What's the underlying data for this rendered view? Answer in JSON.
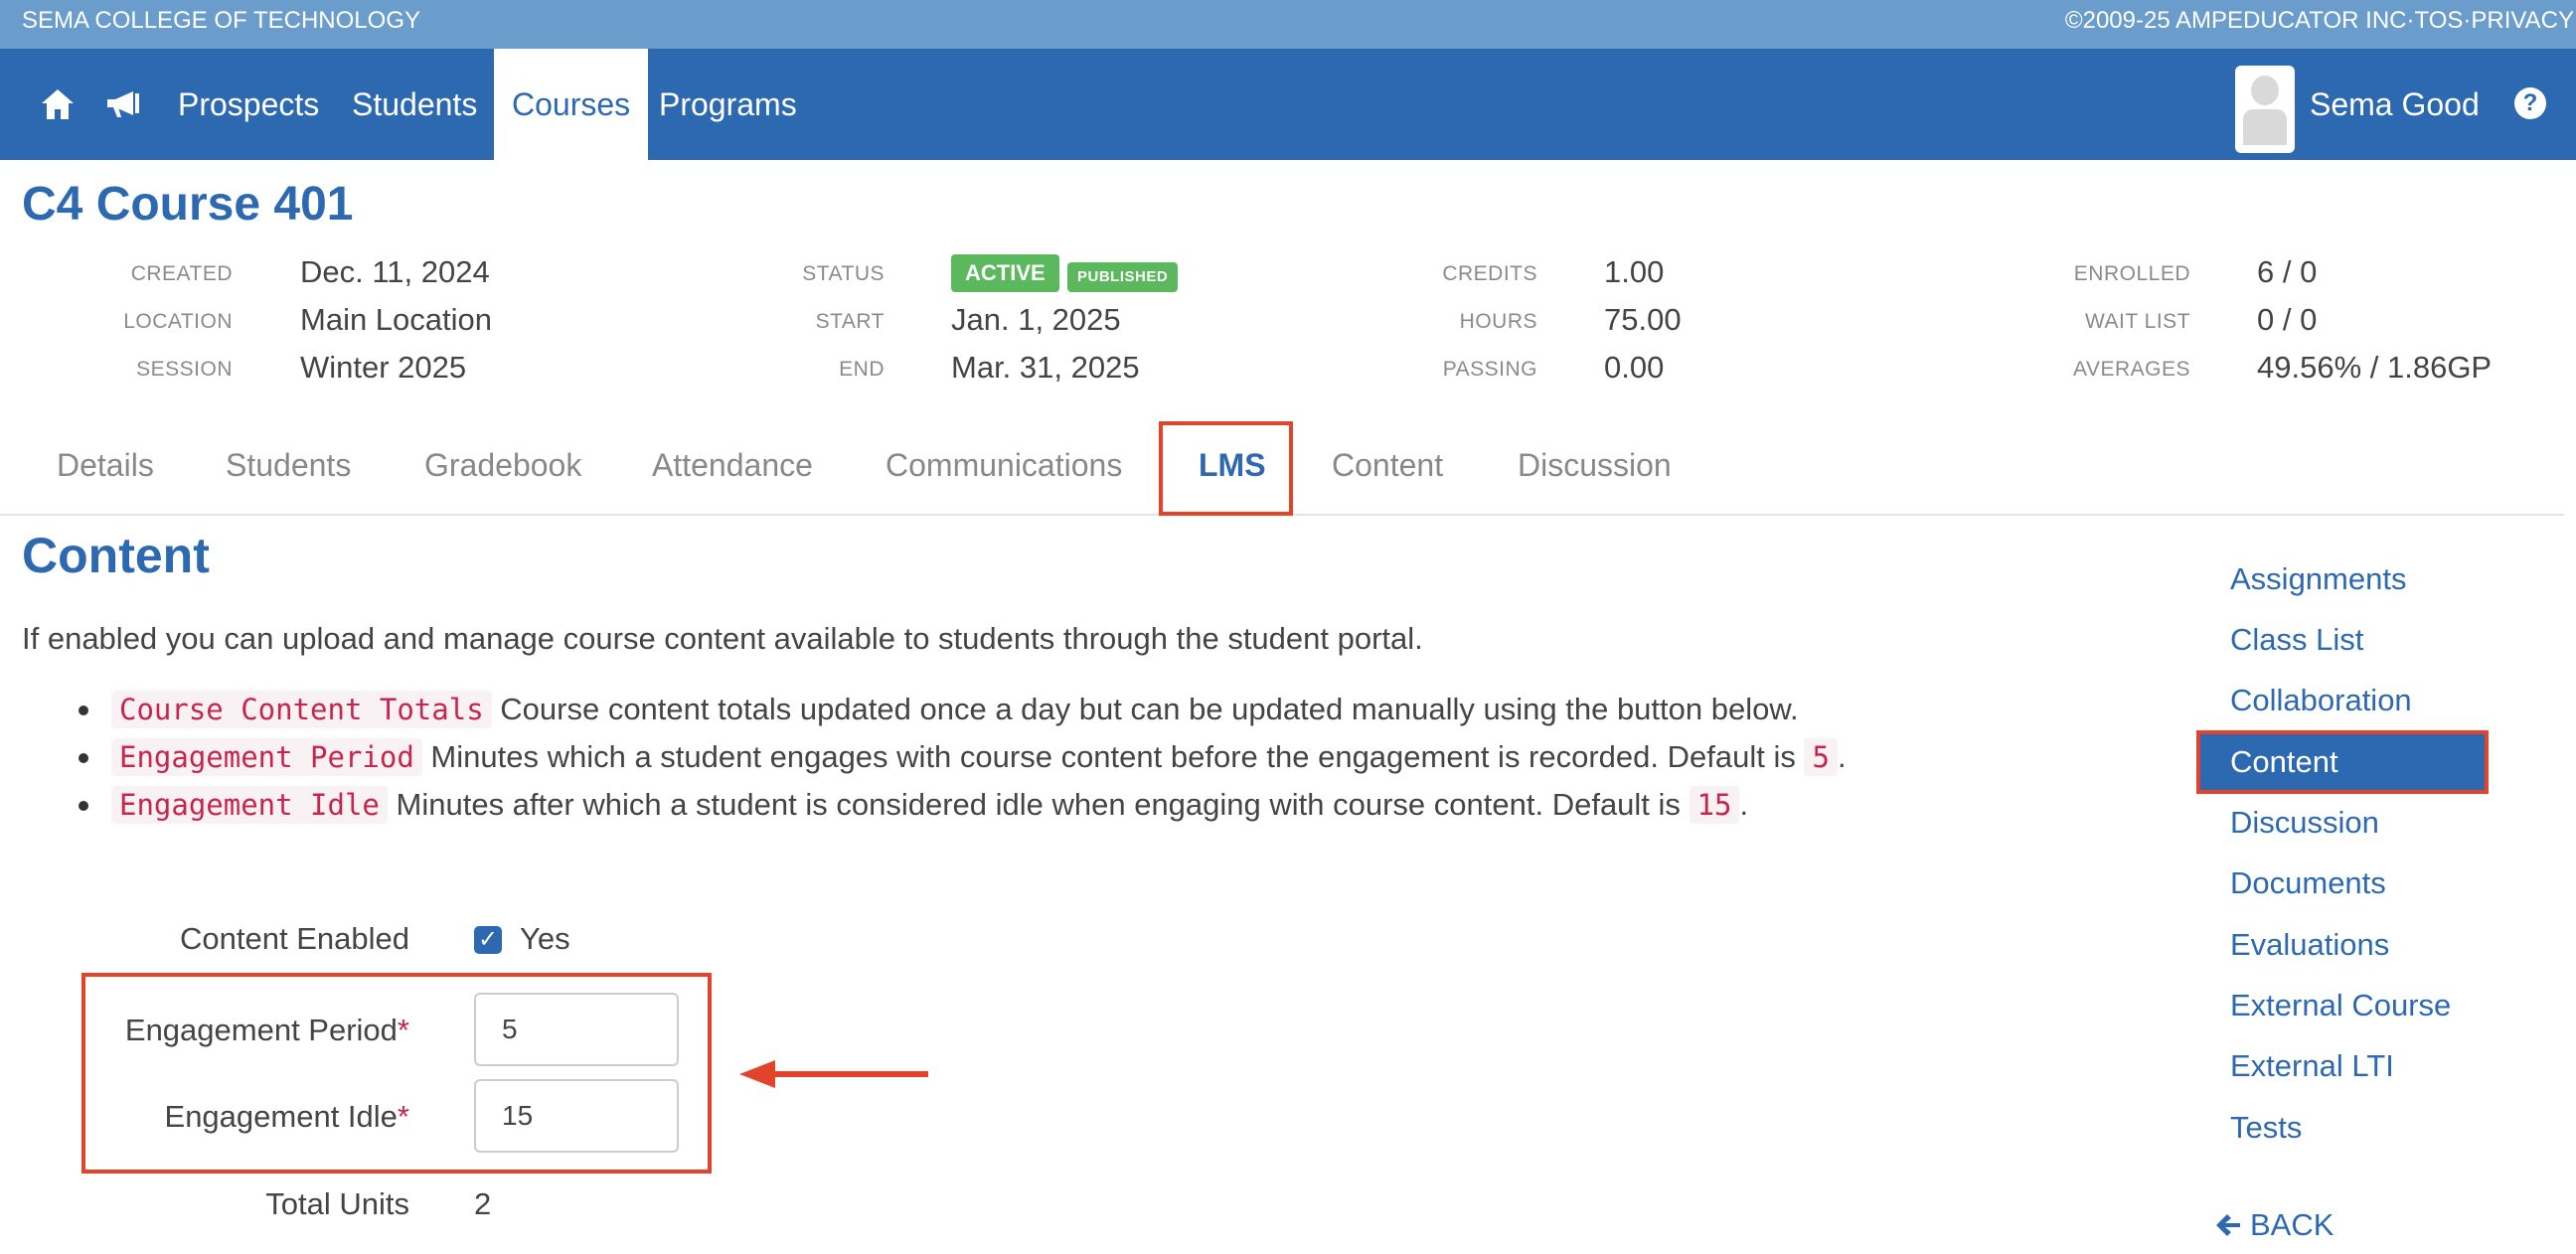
{
  "topbar": {
    "school": "SEMA COLLEGE OF TECHNOLOGY",
    "copyright": "©2009-25 AMPEDUCATOR INC",
    "tos": "TOS",
    "privacy": "PRIVACY",
    "separator": "·"
  },
  "nav": {
    "home_icon": "home-icon",
    "announce_icon": "megaphone-icon",
    "items": [
      {
        "label": "Prospects"
      },
      {
        "label": "Students"
      },
      {
        "label": "Courses",
        "active": true
      },
      {
        "label": "Programs"
      }
    ],
    "user_name": "Sema Good",
    "help_label": "?"
  },
  "course": {
    "title": "C4 Course 401",
    "meta": {
      "created_label": "CREATED",
      "created": "Dec. 11, 2024",
      "location_label": "LOCATION",
      "location": "Main Location",
      "session_label": "SESSION",
      "session": "Winter 2025",
      "status_label": "STATUS",
      "status_active": "ACTIVE",
      "status_published": "PUBLISHED",
      "start_label": "START",
      "start": "Jan. 1, 2025",
      "end_label": "END",
      "end": "Mar. 31, 2025",
      "credits_label": "CREDITS",
      "credits": "1.00",
      "hours_label": "HOURS",
      "hours": "75.00",
      "passing_label": "PASSING",
      "passing": "0.00",
      "enrolled_label": "ENROLLED",
      "enrolled": "6 / 0",
      "waitlist_label": "WAIT LIST",
      "waitlist": "0 / 0",
      "averages_label": "AVERAGES",
      "averages": "49.56% / 1.86GP"
    }
  },
  "tabs": [
    {
      "label": "Details"
    },
    {
      "label": "Students"
    },
    {
      "label": "Gradebook"
    },
    {
      "label": "Attendance"
    },
    {
      "label": "Communications"
    },
    {
      "label": "LMS",
      "active": true
    },
    {
      "label": "Content"
    },
    {
      "label": "Discussion"
    }
  ],
  "content": {
    "title": "Content",
    "intro": "If enabled you can upload and manage course content available to students through the student portal.",
    "bullets": [
      {
        "code": "Course Content Totals",
        "text": " Course content totals updated once a day but can be updated manually using the button below.",
        "default_prefix": "",
        "default_code": "",
        "default_suffix": ""
      },
      {
        "code": "Engagement Period",
        "text": " Minutes which a student engages with course content before the engagement is recorded. Default is ",
        "default_code": "5",
        "default_suffix": "."
      },
      {
        "code": "Engagement Idle",
        "text": " Minutes after which a student is considered idle when engaging with course content. Default is ",
        "default_code": "15",
        "default_suffix": "."
      }
    ],
    "form": {
      "enabled_label": "Content Enabled",
      "enabled_value": "Yes",
      "enabled_checked": true,
      "period_label": "Engagement Period",
      "period_value": "5",
      "idle_label": "Engagement Idle",
      "idle_value": "15",
      "required_mark": "*",
      "total_units_label": "Total Units",
      "total_units_value": "2"
    }
  },
  "sidebar": {
    "items": [
      {
        "label": "Assignments"
      },
      {
        "label": "Class List"
      },
      {
        "label": "Collaboration"
      },
      {
        "label": "Content",
        "active": true
      },
      {
        "label": "Discussion"
      },
      {
        "label": "Documents"
      },
      {
        "label": "Evaluations"
      },
      {
        "label": "External Course"
      },
      {
        "label": "External LTI"
      },
      {
        "label": "Tests"
      }
    ],
    "back_label": "BACK"
  },
  "colors": {
    "brand_blue": "#2d69b0",
    "top_strip": "#6b9dcc",
    "badge_green": "#5cb85c",
    "highlight_red": "#e2432b",
    "code_red": "#c7254e"
  }
}
